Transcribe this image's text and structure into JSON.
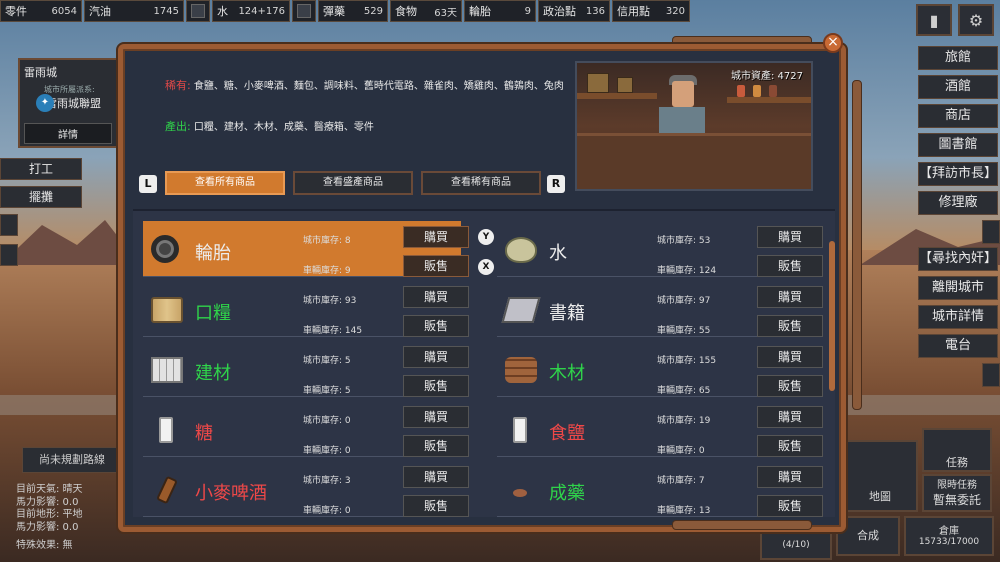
{
  "topbar": {
    "resources": [
      {
        "label": "零件",
        "value": "6054"
      },
      {
        "label": "汽油",
        "value": "1745"
      },
      {
        "label": "水",
        "value": "124+176"
      },
      {
        "label": "彈藥",
        "value": "529"
      },
      {
        "label": "食物",
        "value": "63天"
      },
      {
        "label": "輪胎",
        "value": "9"
      },
      {
        "label": "政治點",
        "value": "136"
      },
      {
        "label": "信用點",
        "value": "320"
      }
    ]
  },
  "city_card": {
    "name": "雷雨城",
    "subtitle": "城市所屬派系:",
    "alliance": "雷雨城聯盟",
    "detail_label": "詳情"
  },
  "left_actions": {
    "work": "打工",
    "stall": "擺攤"
  },
  "route": {
    "label": "尚未規劃路線"
  },
  "status_lines": [
    "目前天氣: 晴天",
    "馬力影響: 0.0",
    "目前地形: 平地",
    "馬力影響: 0.0",
    "特殊效果: 無"
  ],
  "right_menu": [
    "旅館",
    "酒館",
    "商店",
    "圖書館",
    "【拜訪市長】",
    "修理廠",
    "【尋找內奸】",
    "離開城市",
    "城市詳情",
    "電台"
  ],
  "bottom_right": {
    "map": "地圖",
    "tasks": "任務",
    "limited_task": "限時任務",
    "no_commission": "暫無委託",
    "craft": "合成",
    "warehouse": "倉庫",
    "warehouse_cap": "15733/17000",
    "counter": "(4/10)"
  },
  "dialog": {
    "rare_label": "稀有:",
    "rare_items": "食鹽、糖、小麥啤酒、麵包、調味料、舊時代電路、雜雀肉、矯雞肉、鶴鶉肉、兔肉",
    "produce_label": "產出:",
    "produce_items": "口糧、建材、木材、成藥、醫療箱、零件",
    "wealth": "城市資產: 4727",
    "key_left": "L",
    "key_right": "R",
    "tabs": [
      "查看所有商品",
      "查看盛產商品",
      "查看稀有商品"
    ],
    "key_y": "Y",
    "key_x": "X",
    "city_stock_label": "城市庫存:",
    "vehicle_stock_label": "車輛庫存:",
    "buy_label": "購買",
    "sell_label": "販售"
  },
  "goods": [
    {
      "name": "輪胎",
      "icon": "tire-icon",
      "color": "white",
      "city": "8",
      "vehicle": "9"
    },
    {
      "name": "水",
      "icon": "water-flask-icon",
      "color": "white",
      "city": "53",
      "vehicle": "124"
    },
    {
      "name": "口糧",
      "icon": "ration-can-icon",
      "color": "green",
      "city": "93",
      "vehicle": "145"
    },
    {
      "name": "書籍",
      "icon": "book-icon",
      "color": "white",
      "city": "97",
      "vehicle": "55"
    },
    {
      "name": "建材",
      "icon": "brick-icon",
      "color": "green",
      "city": "5",
      "vehicle": "5"
    },
    {
      "name": "木材",
      "icon": "wood-log-icon",
      "color": "green",
      "city": "155",
      "vehicle": "65"
    },
    {
      "name": "糖",
      "icon": "sugar-bag-icon",
      "color": "red",
      "city": "0",
      "vehicle": "0"
    },
    {
      "name": "食鹽",
      "icon": "salt-bag-icon",
      "color": "red",
      "city": "19",
      "vehicle": "0"
    },
    {
      "name": "小麥啤酒",
      "icon": "beer-bottle-icon",
      "color": "red",
      "city": "3",
      "vehicle": "0"
    },
    {
      "name": "成藥",
      "icon": "pill-icon",
      "color": "green",
      "city": "7",
      "vehicle": "13"
    }
  ]
}
